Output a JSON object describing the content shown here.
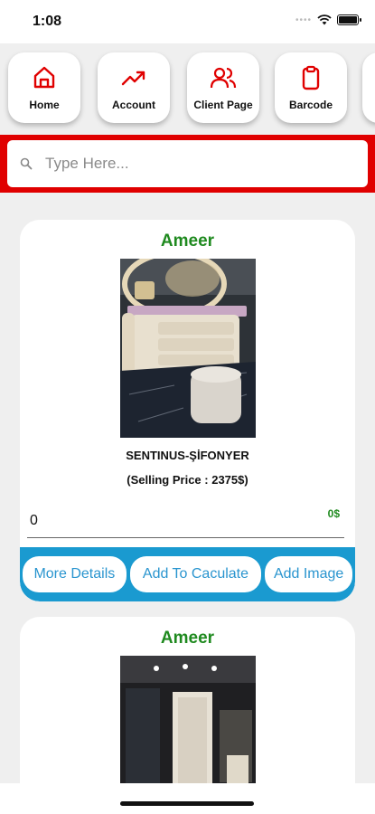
{
  "status": {
    "time": "1:08"
  },
  "nav": [
    {
      "label": "Home",
      "icon": "home-icon"
    },
    {
      "label": "Account",
      "icon": "trend-up-icon"
    },
    {
      "label": "Client Page",
      "icon": "users-icon"
    },
    {
      "label": "Barcode",
      "icon": "clipboard-icon"
    }
  ],
  "search": {
    "placeholder": "Type Here..."
  },
  "products": [
    {
      "owner": "Ameer",
      "name": "SENTINUS-ŞİFONYER",
      "price_text": "(Selling Price : 2375$)",
      "quantity": "0",
      "total": "0$",
      "actions": [
        "More Details",
        "Add To Caculate",
        "Add Image"
      ]
    },
    {
      "owner": "Ameer"
    }
  ],
  "colors": {
    "accent_red": "#e00000",
    "owner_green": "#1f8a1f",
    "action_blue": "#1a9ad0"
  }
}
